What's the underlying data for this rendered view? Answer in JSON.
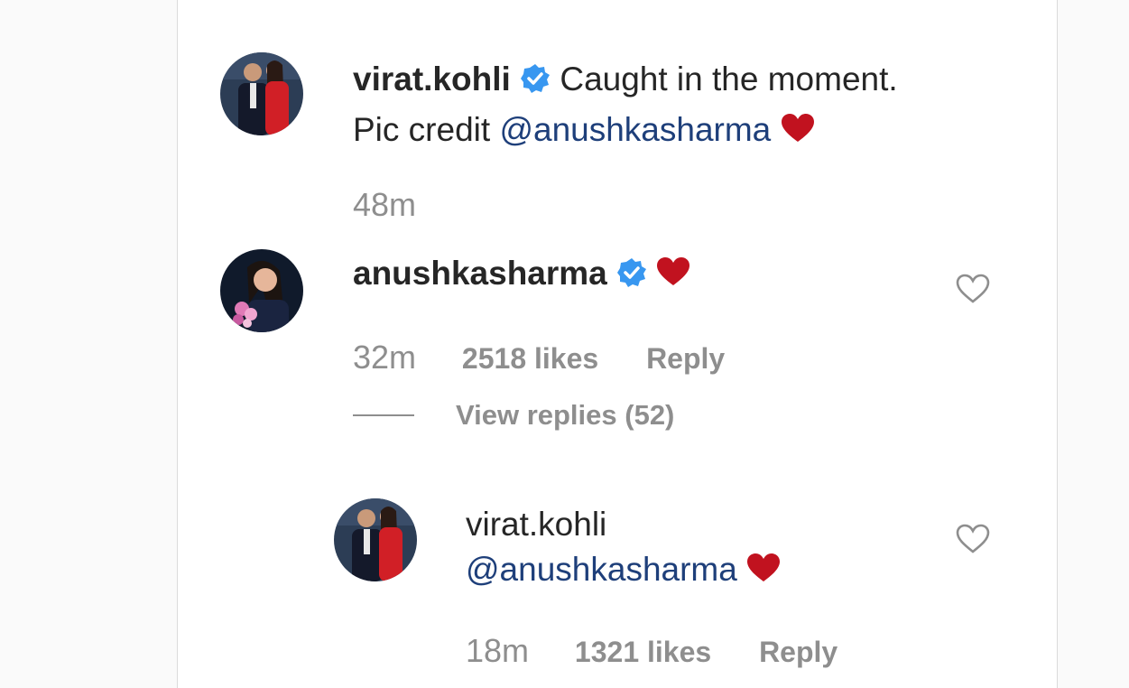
{
  "post": {
    "caption": {
      "username": "virat.kohli",
      "text_line1": "Caught in the moment.",
      "text_line2_prefix": "Pic credit ",
      "mention": "@anushkasharma",
      "time": "48m"
    }
  },
  "comments": [
    {
      "username": "anushkasharma",
      "time": "32m",
      "likes": "2518 likes",
      "reply_label": "Reply",
      "view_replies": "View replies (52)"
    }
  ],
  "replies": [
    {
      "username": "virat.kohli",
      "mention": "@anushkasharma",
      "time": "18m",
      "likes": "1321 likes",
      "reply_label": "Reply"
    }
  ],
  "icons": {
    "verified": "verified-badge-icon",
    "heart_emoji": "red-heart-emoji",
    "like": "heart-outline-icon"
  },
  "colors": {
    "verified_blue": "#3897f0",
    "heart_red": "#c1121f",
    "mention_blue": "#1e3f7a",
    "meta_gray": "#8e8e8e"
  }
}
